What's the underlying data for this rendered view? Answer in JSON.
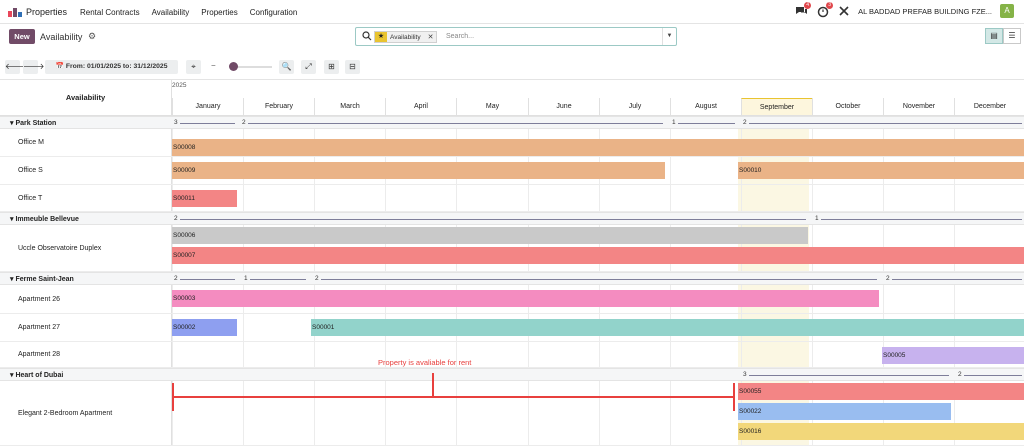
{
  "navbar": {
    "app_name": "Properties",
    "menu": [
      "Rental Contracts",
      "Availability",
      "Properties",
      "Configuration"
    ],
    "messages_count": "4",
    "activities_count": "3",
    "company": "AL BADDAD PREFAB BUILDING FZE...",
    "avatar_letter": "A"
  },
  "control": {
    "new_label": "New",
    "title": "Availability",
    "facet_label": "Availability",
    "search_placeholder": "Search..."
  },
  "toolbar": {
    "date_range": "From: 01/01/2025 to: 31/12/2025"
  },
  "gantt": {
    "corner_label": "Availability",
    "year": "2025",
    "months": [
      "January",
      "February",
      "March",
      "April",
      "May",
      "June",
      "July",
      "August",
      "September",
      "October",
      "November",
      "December"
    ],
    "current_month": "September",
    "groups": [
      {
        "name": "Park Station",
        "counters": [
          "3",
          "2",
          "1",
          "2"
        ],
        "rows": [
          {
            "name": "Office M",
            "pills": [
              {
                "label": "S00008",
                "color": "#eab387"
              }
            ]
          },
          {
            "name": "Office S",
            "pills": [
              {
                "label": "S00009",
                "color": "#eab387"
              },
              {
                "label": "S00010",
                "color": "#eab387"
              }
            ]
          },
          {
            "name": "Office T",
            "pills": [
              {
                "label": "S00011",
                "color": "#f38585"
              }
            ]
          }
        ]
      },
      {
        "name": "Immeuble Bellevue",
        "counters": [
          "2",
          "1"
        ],
        "rows": [
          {
            "name": "Uccle Observatoire Duplex",
            "pills": [
              {
                "label": "S00006",
                "color": "#c9c9c9"
              },
              {
                "label": "S00007",
                "color": "#f38585"
              }
            ]
          }
        ]
      },
      {
        "name": "Ferme Saint-Jean",
        "counters": [
          "2",
          "1",
          "2",
          "2"
        ],
        "rows": [
          {
            "name": "Apartment 26",
            "pills": [
              {
                "label": "S00003",
                "color": "#f48cc0"
              }
            ]
          },
          {
            "name": "Apartment 27",
            "pills": [
              {
                "label": "S00002",
                "color": "#8e9ff0"
              },
              {
                "label": "S00001",
                "color": "#92d3cb"
              }
            ]
          },
          {
            "name": "Apartment 28",
            "pills": [
              {
                "label": "S00005",
                "color": "#c7b2ee"
              }
            ]
          }
        ]
      },
      {
        "name": "Heart of Dubai",
        "counters": [
          "3",
          "2"
        ],
        "rows": [
          {
            "name": "Elegant 2-Bedroom Apartment",
            "pills": [
              {
                "label": "S00055",
                "color": "#f38585"
              },
              {
                "label": "S00022",
                "color": "#99bdf0"
              },
              {
                "label": "S00016",
                "color": "#f2d77a"
              }
            ]
          }
        ]
      }
    ],
    "annotation": "Property is avaliable for rent"
  }
}
